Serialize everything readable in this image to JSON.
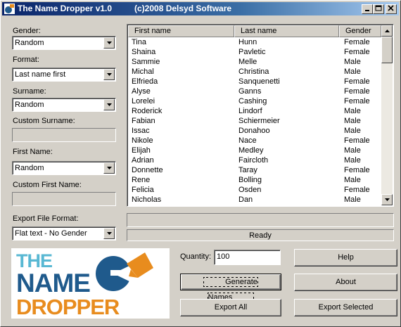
{
  "window": {
    "title": "The Name Dropper v1.0",
    "copyright": "(c)2008 Delsyd Software"
  },
  "controls": {
    "gender_label": "Gender:",
    "gender_value": "Random",
    "format_label": "Format:",
    "format_value": "Last name first",
    "surname_label": "Surname:",
    "surname_value": "Random",
    "custom_surname_label": "Custom Surname:",
    "first_name_label": "First Name:",
    "first_name_value": "Random",
    "custom_first_name_label": "Custom First Name:",
    "export_format_label": "Export File Format:",
    "export_format_value": "Flat text - No Gender"
  },
  "table": {
    "columns": [
      "First name",
      "Last name",
      "Gender"
    ],
    "rows": [
      [
        "Tina",
        "Hunn",
        "Female"
      ],
      [
        "Shaina",
        "Pavletic",
        "Female"
      ],
      [
        "Sammie",
        "Melle",
        "Male"
      ],
      [
        "Michal",
        "Christina",
        "Male"
      ],
      [
        "Elfrieda",
        "Sanquenetti",
        "Female"
      ],
      [
        "Alyse",
        "Ganns",
        "Female"
      ],
      [
        "Lorelei",
        "Cashing",
        "Female"
      ],
      [
        "Roderick",
        "Lindorf",
        "Male"
      ],
      [
        "Fabian",
        "Schiermeier",
        "Male"
      ],
      [
        "Issac",
        "Donahoo",
        "Male"
      ],
      [
        "Nikole",
        "Nace",
        "Female"
      ],
      [
        "Elijah",
        "Medley",
        "Male"
      ],
      [
        "Adrian",
        "Faircloth",
        "Male"
      ],
      [
        "Donnette",
        "Taray",
        "Female"
      ],
      [
        "Rene",
        "Bolling",
        "Male"
      ],
      [
        "Felicia",
        "Osden",
        "Female"
      ],
      [
        "Nicholas",
        "Dan",
        "Male"
      ]
    ]
  },
  "status": "Ready",
  "logo": {
    "line1": "THE",
    "line2": "NAME",
    "line3": "DROPPER"
  },
  "quantity": {
    "label": "Quantity:",
    "value": "100"
  },
  "buttons": {
    "help": "Help",
    "generate": "Generate Names",
    "about": "About",
    "export_all": "Export All",
    "export_selected": "Export Selected"
  },
  "colors": {
    "titlebar": "#0a246a",
    "logo_orange": "#e88c1e",
    "logo_blue": "#1f5a8c",
    "logo_light_blue": "#58b8d3"
  }
}
